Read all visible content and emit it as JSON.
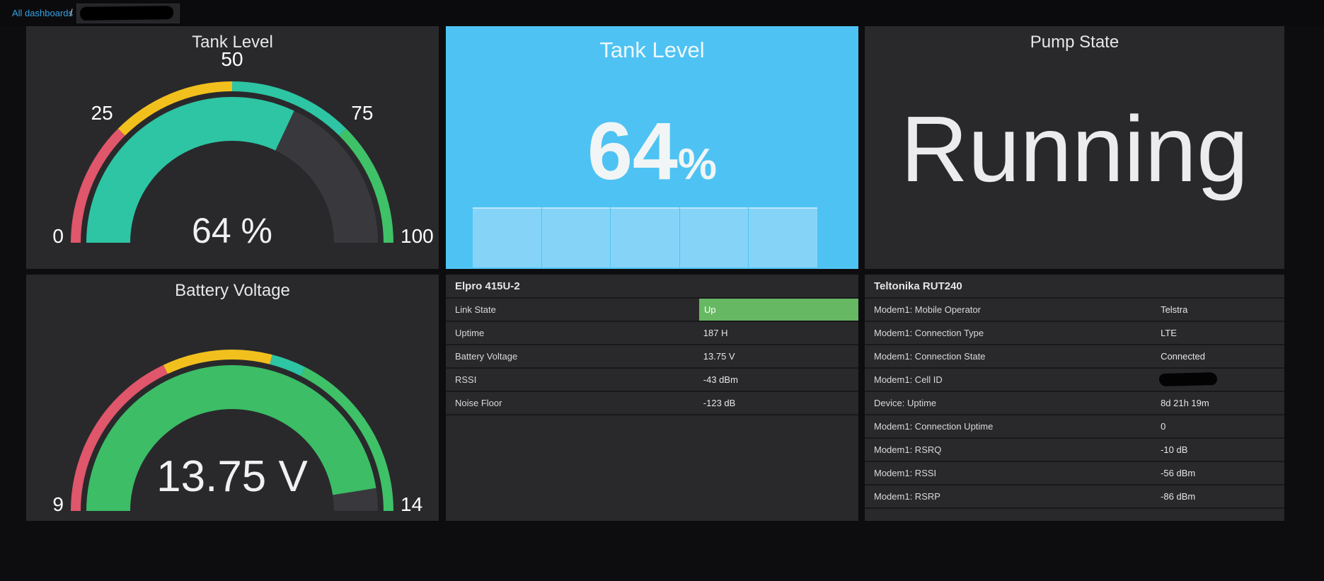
{
  "breadcrumb": {
    "link": "All dashboards",
    "separator": "/",
    "dashboard_name_redacted": true
  },
  "panels": {
    "tank_gauge": {
      "title": "Tank Level",
      "value": 64,
      "display": "64 %",
      "min": 0,
      "max": 100,
      "ticks": [
        {
          "label": "0",
          "value": 0
        },
        {
          "label": "25",
          "value": 25
        },
        {
          "label": "50",
          "value": 50
        },
        {
          "label": "75",
          "value": 75
        },
        {
          "label": "100",
          "value": 100
        }
      ],
      "thresholds": [
        {
          "to": 25,
          "color": "#e0566a"
        },
        {
          "to": 50,
          "color": "#f2c01d"
        },
        {
          "to": 75,
          "color": "#2dc5a4"
        },
        {
          "to": 100,
          "color": "#3fc168"
        }
      ],
      "arc_color": "#2dc5a4",
      "remainder_color": "#39393d"
    },
    "tank_stat": {
      "title": "Tank Level",
      "value": "64",
      "unit": "%",
      "bg": "#4ec3f3",
      "bar_color": "#85d4f7",
      "sparkline_values": [
        64,
        64,
        64,
        64,
        64
      ]
    },
    "pump": {
      "title": "Pump State",
      "value": "Running"
    },
    "battery_gauge": {
      "title": "Battery Voltage",
      "value": 13.75,
      "display": "13.75 V",
      "min": 9,
      "max": 14,
      "ticks": [
        {
          "label": "9",
          "value": 9
        },
        {
          "label": "14",
          "value": 14
        }
      ],
      "thresholds": [
        {
          "to": 10.8,
          "color": "#e0566a"
        },
        {
          "to": 11.9,
          "color": "#f2c01d"
        },
        {
          "to": 12.25,
          "color": "#2dc5a4"
        },
        {
          "to": 14,
          "color": "#3fc168"
        }
      ],
      "arc_color": "#3cbd66",
      "remainder_color": "#39393d"
    },
    "elpro": {
      "title": "Elpro 415U-2",
      "highlight_color": "#67b862",
      "rows": [
        {
          "label": "Link State",
          "value": "Up"
        },
        {
          "label": "Uptime",
          "value": "187 H"
        },
        {
          "label": "Battery Voltage",
          "value": "13.75 V"
        },
        {
          "label": "RSSI",
          "value": "-43 dBm"
        },
        {
          "label": "Noise Floor",
          "value": "-123 dB"
        }
      ]
    },
    "teltonika": {
      "title": "Teltonika RUT240",
      "rows": [
        {
          "label": "Modem1: Mobile Operator",
          "value": "Telstra"
        },
        {
          "label": "Modem1: Connection Type",
          "value": "LTE"
        },
        {
          "label": "Modem1: Connection State",
          "value": "Connected"
        },
        {
          "label": "Modem1: Cell ID",
          "value": "",
          "redacted": true
        },
        {
          "label": "Device: Uptime",
          "value": "8d 21h 19m"
        },
        {
          "label": "Modem1: Connection Uptime",
          "value": "0"
        },
        {
          "label": "Modem1: RSRQ",
          "value": "-10 dB"
        },
        {
          "label": "Modem1: RSSI",
          "value": "-56 dBm"
        },
        {
          "label": "Modem1: RSRP",
          "value": "-86 dBm"
        }
      ]
    }
  },
  "chart_data": [
    {
      "type": "gauge",
      "title": "Tank Level",
      "value": 64,
      "unit": "%",
      "min": 0,
      "max": 100,
      "thresholds": [
        25,
        50,
        75
      ]
    },
    {
      "type": "gauge",
      "title": "Battery Voltage",
      "value": 13.75,
      "unit": "V",
      "min": 9,
      "max": 14,
      "thresholds": [
        10.8,
        11.9,
        12.25
      ]
    },
    {
      "type": "table",
      "title": "Elpro 415U-2",
      "rows": [
        [
          "Link State",
          "Up"
        ],
        [
          "Uptime",
          "187 H"
        ],
        [
          "Battery Voltage",
          "13.75 V"
        ],
        [
          "RSSI",
          "-43 dBm"
        ],
        [
          "Noise Floor",
          "-123 dB"
        ]
      ]
    },
    {
      "type": "table",
      "title": "Teltonika RUT240",
      "rows": [
        [
          "Modem1: Mobile Operator",
          "Telstra"
        ],
        [
          "Modem1: Connection Type",
          "LTE"
        ],
        [
          "Modem1: Connection State",
          "Connected"
        ],
        [
          "Modem1: Cell ID",
          "(redacted)"
        ],
        [
          "Device: Uptime",
          "8d 21h 19m"
        ],
        [
          "Modem1: Connection Uptime",
          "0"
        ],
        [
          "Modem1: RSRQ",
          "-10 dB"
        ],
        [
          "Modem1: RSSI",
          "-56 dBm"
        ],
        [
          "Modem1: RSRP",
          "-86 dBm"
        ]
      ]
    }
  ]
}
